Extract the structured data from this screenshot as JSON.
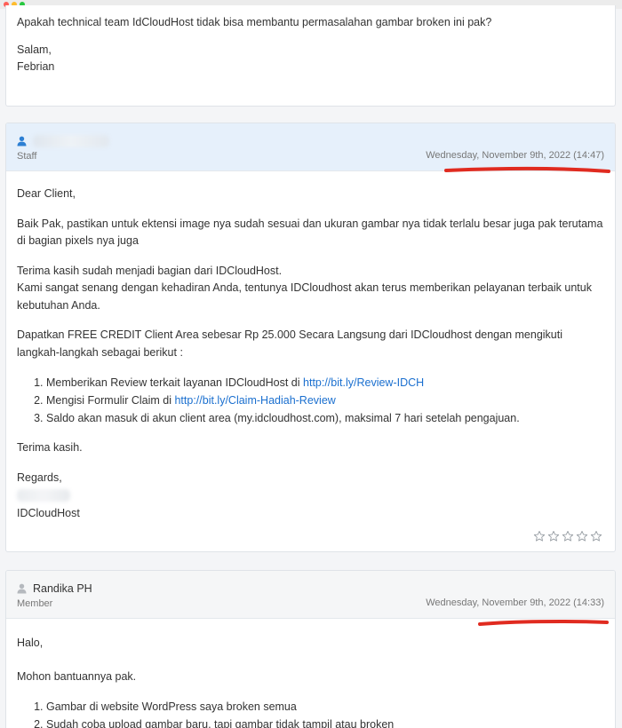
{
  "previous_reply": {
    "question": "Apakah technical team IdCloudHost tidak bisa membantu permasalahan gambar broken ini pak?",
    "greeting": "Salam,",
    "name": "Febrian"
  },
  "staff_reply": {
    "role": "Staff",
    "date": "Wednesday, November 9th, 2022 (14:47)",
    "opening": "Dear Client,",
    "paragraph_1": "Baik Pak, pastikan untuk ektensi image nya sudah sesuai dan ukuran gambar nya tidak terlalu besar juga pak terutama di bagian pixels nya juga",
    "paragraph_2_line_1": "Terima kasih sudah menjadi bagian dari IDCloudHost.",
    "paragraph_2_line_2": "Kami sangat senang dengan kehadiran Anda, tentunya IDCloudhost akan terus memberikan pelayanan terbaik untuk kebutuhan Anda.",
    "paragraph_3": "Dapatkan FREE CREDIT Client Area sebesar Rp 25.000 Secara Langsung dari IDCloudhost dengan mengikuti langkah-langkah sebagai berikut :",
    "steps": [
      {
        "text": "Memberikan Review terkait layanan IDCloudHost di ",
        "link": "http://bit.ly/Review-IDCH"
      },
      {
        "text": "Mengisi Formulir Claim di ",
        "link": "http://bit.ly/Claim-Hadiah-Review"
      },
      {
        "text": "Saldo akan masuk di akun client area (my.idcloudhost.com), maksimal 7 hari setelah pengajuan.",
        "link": ""
      }
    ],
    "thanks": "Terima kasih.",
    "regards": "Regards,",
    "company": "IDCloudHost",
    "rating_stars": 5,
    "rating_filled": 0
  },
  "member_reply": {
    "name": "Randika PH",
    "role": "Member",
    "date": "Wednesday, November 9th, 2022 (14:33)",
    "greeting": "Halo,",
    "request": "Mohon bantuannya pak.",
    "items": [
      "Gambar di website WordPress saya broken semua",
      "Sudah coba upload gambar baru, tapi gambar tidak tampil atau broken"
    ]
  },
  "colors": {
    "link": "#1a6fcf",
    "staff_header": "#e6f0fb",
    "member_header": "#f5f6f7",
    "annotation": "#e02b20"
  },
  "icons": {
    "staff_user": "user-icon-blue",
    "member_user": "user-icon-grey",
    "rating": "star-outline-icon"
  }
}
